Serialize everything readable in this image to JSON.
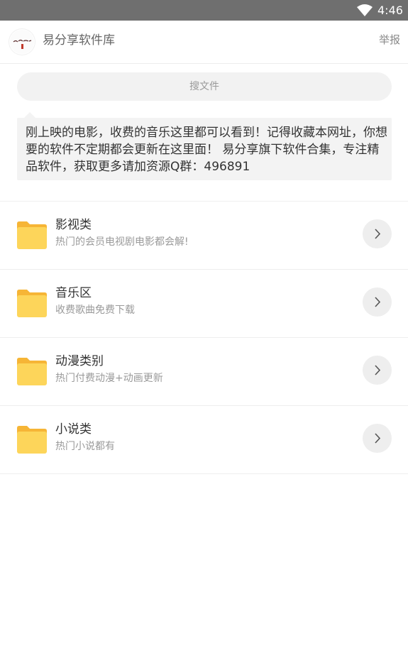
{
  "status_bar": {
    "time": "4:46",
    "wifi_icon": "wifi-icon"
  },
  "header": {
    "title": "易分享软件库",
    "report": "举报",
    "logo_icon": "app-logo-icon"
  },
  "search": {
    "placeholder": "搜文件"
  },
  "notice": {
    "text": "刚上映的电影，收费的音乐这里都可以看到！记得收藏本网址，你想要的软件不定期都会更新在这里面！ 易分享旗下软件合集，专注精品软件，获取更多请加资源Q群：496891"
  },
  "colors": {
    "folder": "#fdd55a",
    "folder_tab": "#f6b536",
    "status_bar": "#6f6f6f"
  },
  "categories": [
    {
      "title": "影视类",
      "desc": "热门的会员电视剧电影都会解!"
    },
    {
      "title": "音乐区",
      "desc": "收费歌曲免费下载"
    },
    {
      "title": "动漫类别",
      "desc": "热门付费动漫+动画更新"
    },
    {
      "title": "小说类",
      "desc": "热门小说都有"
    }
  ]
}
